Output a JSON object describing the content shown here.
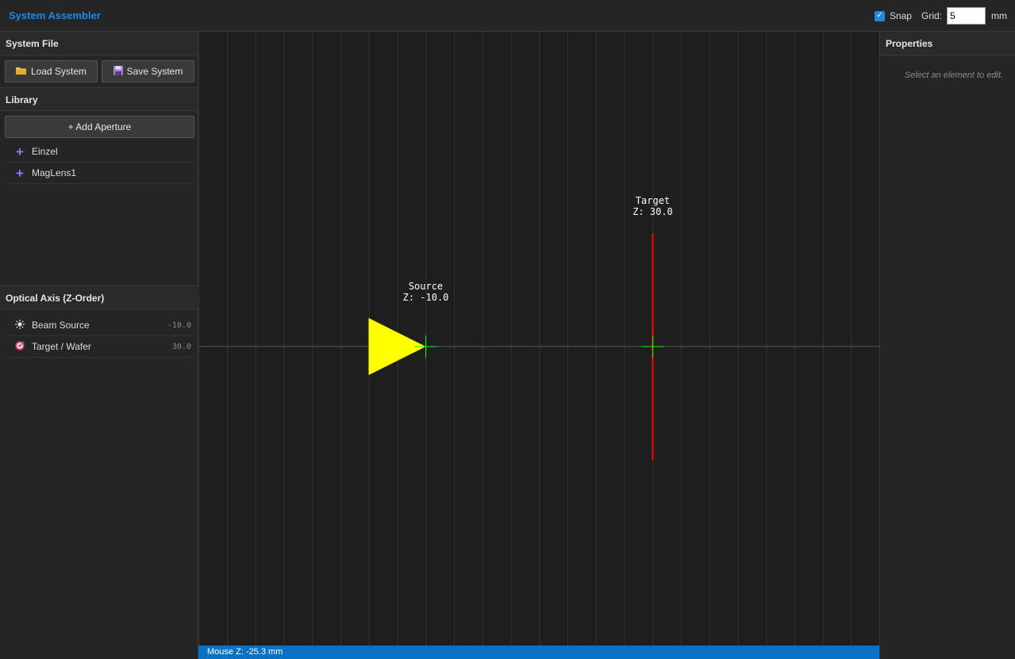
{
  "header": {
    "title": "System Assembler",
    "snap_label": "Snap",
    "snap_checked": true,
    "grid_label": "Grid:",
    "grid_value": "5",
    "grid_unit": "mm"
  },
  "left_panel": {
    "system_file": {
      "title": "System File",
      "load_label": "Load System",
      "save_label": "Save System"
    },
    "library": {
      "title": "Library",
      "add_label": "+ Add Aperture",
      "items": [
        {
          "label": "Einzel"
        },
        {
          "label": "MagLens1"
        }
      ]
    },
    "optical_axis": {
      "title": "Optical Axis (Z-Order)",
      "items": [
        {
          "label": "Beam Source",
          "z": "-10.0",
          "icon": "sun-icon"
        },
        {
          "label": "Target / Wafer",
          "z": "30.0",
          "icon": "target-icon"
        }
      ]
    }
  },
  "canvas": {
    "source": {
      "name": "Source",
      "z_text": "Z: -10.0",
      "z": -10,
      "color": "#ffff00"
    },
    "target": {
      "name": "Target",
      "z_text": "Z: 30.0",
      "z": 30,
      "color": "#ff0000"
    },
    "marker_color": "#00ff00"
  },
  "status": {
    "mouse_text": "Mouse Z: -25.3 mm"
  },
  "right_panel": {
    "title": "Properties",
    "empty_text": "Select an element to edit."
  }
}
